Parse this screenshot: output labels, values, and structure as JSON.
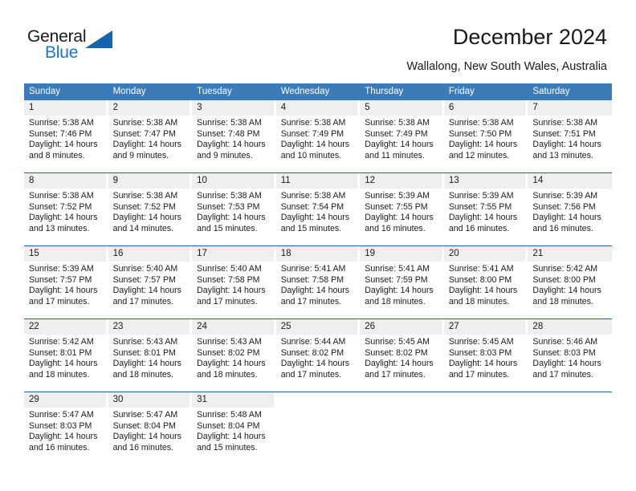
{
  "brand": {
    "name_part1": "General",
    "name_part2": "Blue",
    "accent_color": "#1565ac",
    "logo_icon": "triangle-flag-icon"
  },
  "header": {
    "title": "December 2024",
    "subtitle": "Wallalong, New South Wales, Australia"
  },
  "calendar": {
    "header_bg": "#3b7cb8",
    "daynum_bg": "#efefef",
    "row_border_color": "#1565ac",
    "weekdays": [
      "Sunday",
      "Monday",
      "Tuesday",
      "Wednesday",
      "Thursday",
      "Friday",
      "Saturday"
    ],
    "weeks": [
      [
        {
          "day": "1",
          "sunrise": "Sunrise: 5:38 AM",
          "sunset": "Sunset: 7:46 PM",
          "daylight_line1": "Daylight: 14 hours",
          "daylight_line2": "and 8 minutes."
        },
        {
          "day": "2",
          "sunrise": "Sunrise: 5:38 AM",
          "sunset": "Sunset: 7:47 PM",
          "daylight_line1": "Daylight: 14 hours",
          "daylight_line2": "and 9 minutes."
        },
        {
          "day": "3",
          "sunrise": "Sunrise: 5:38 AM",
          "sunset": "Sunset: 7:48 PM",
          "daylight_line1": "Daylight: 14 hours",
          "daylight_line2": "and 9 minutes."
        },
        {
          "day": "4",
          "sunrise": "Sunrise: 5:38 AM",
          "sunset": "Sunset: 7:49 PM",
          "daylight_line1": "Daylight: 14 hours",
          "daylight_line2": "and 10 minutes."
        },
        {
          "day": "5",
          "sunrise": "Sunrise: 5:38 AM",
          "sunset": "Sunset: 7:49 PM",
          "daylight_line1": "Daylight: 14 hours",
          "daylight_line2": "and 11 minutes."
        },
        {
          "day": "6",
          "sunrise": "Sunrise: 5:38 AM",
          "sunset": "Sunset: 7:50 PM",
          "daylight_line1": "Daylight: 14 hours",
          "daylight_line2": "and 12 minutes."
        },
        {
          "day": "7",
          "sunrise": "Sunrise: 5:38 AM",
          "sunset": "Sunset: 7:51 PM",
          "daylight_line1": "Daylight: 14 hours",
          "daylight_line2": "and 13 minutes."
        }
      ],
      [
        {
          "day": "8",
          "sunrise": "Sunrise: 5:38 AM",
          "sunset": "Sunset: 7:52 PM",
          "daylight_line1": "Daylight: 14 hours",
          "daylight_line2": "and 13 minutes."
        },
        {
          "day": "9",
          "sunrise": "Sunrise: 5:38 AM",
          "sunset": "Sunset: 7:52 PM",
          "daylight_line1": "Daylight: 14 hours",
          "daylight_line2": "and 14 minutes."
        },
        {
          "day": "10",
          "sunrise": "Sunrise: 5:38 AM",
          "sunset": "Sunset: 7:53 PM",
          "daylight_line1": "Daylight: 14 hours",
          "daylight_line2": "and 15 minutes."
        },
        {
          "day": "11",
          "sunrise": "Sunrise: 5:38 AM",
          "sunset": "Sunset: 7:54 PM",
          "daylight_line1": "Daylight: 14 hours",
          "daylight_line2": "and 15 minutes."
        },
        {
          "day": "12",
          "sunrise": "Sunrise: 5:39 AM",
          "sunset": "Sunset: 7:55 PM",
          "daylight_line1": "Daylight: 14 hours",
          "daylight_line2": "and 16 minutes."
        },
        {
          "day": "13",
          "sunrise": "Sunrise: 5:39 AM",
          "sunset": "Sunset: 7:55 PM",
          "daylight_line1": "Daylight: 14 hours",
          "daylight_line2": "and 16 minutes."
        },
        {
          "day": "14",
          "sunrise": "Sunrise: 5:39 AM",
          "sunset": "Sunset: 7:56 PM",
          "daylight_line1": "Daylight: 14 hours",
          "daylight_line2": "and 16 minutes."
        }
      ],
      [
        {
          "day": "15",
          "sunrise": "Sunrise: 5:39 AM",
          "sunset": "Sunset: 7:57 PM",
          "daylight_line1": "Daylight: 14 hours",
          "daylight_line2": "and 17 minutes."
        },
        {
          "day": "16",
          "sunrise": "Sunrise: 5:40 AM",
          "sunset": "Sunset: 7:57 PM",
          "daylight_line1": "Daylight: 14 hours",
          "daylight_line2": "and 17 minutes."
        },
        {
          "day": "17",
          "sunrise": "Sunrise: 5:40 AM",
          "sunset": "Sunset: 7:58 PM",
          "daylight_line1": "Daylight: 14 hours",
          "daylight_line2": "and 17 minutes."
        },
        {
          "day": "18",
          "sunrise": "Sunrise: 5:41 AM",
          "sunset": "Sunset: 7:58 PM",
          "daylight_line1": "Daylight: 14 hours",
          "daylight_line2": "and 17 minutes."
        },
        {
          "day": "19",
          "sunrise": "Sunrise: 5:41 AM",
          "sunset": "Sunset: 7:59 PM",
          "daylight_line1": "Daylight: 14 hours",
          "daylight_line2": "and 18 minutes."
        },
        {
          "day": "20",
          "sunrise": "Sunrise: 5:41 AM",
          "sunset": "Sunset: 8:00 PM",
          "daylight_line1": "Daylight: 14 hours",
          "daylight_line2": "and 18 minutes."
        },
        {
          "day": "21",
          "sunrise": "Sunrise: 5:42 AM",
          "sunset": "Sunset: 8:00 PM",
          "daylight_line1": "Daylight: 14 hours",
          "daylight_line2": "and 18 minutes."
        }
      ],
      [
        {
          "day": "22",
          "sunrise": "Sunrise: 5:42 AM",
          "sunset": "Sunset: 8:01 PM",
          "daylight_line1": "Daylight: 14 hours",
          "daylight_line2": "and 18 minutes."
        },
        {
          "day": "23",
          "sunrise": "Sunrise: 5:43 AM",
          "sunset": "Sunset: 8:01 PM",
          "daylight_line1": "Daylight: 14 hours",
          "daylight_line2": "and 18 minutes."
        },
        {
          "day": "24",
          "sunrise": "Sunrise: 5:43 AM",
          "sunset": "Sunset: 8:02 PM",
          "daylight_line1": "Daylight: 14 hours",
          "daylight_line2": "and 18 minutes."
        },
        {
          "day": "25",
          "sunrise": "Sunrise: 5:44 AM",
          "sunset": "Sunset: 8:02 PM",
          "daylight_line1": "Daylight: 14 hours",
          "daylight_line2": "and 17 minutes."
        },
        {
          "day": "26",
          "sunrise": "Sunrise: 5:45 AM",
          "sunset": "Sunset: 8:02 PM",
          "daylight_line1": "Daylight: 14 hours",
          "daylight_line2": "and 17 minutes."
        },
        {
          "day": "27",
          "sunrise": "Sunrise: 5:45 AM",
          "sunset": "Sunset: 8:03 PM",
          "daylight_line1": "Daylight: 14 hours",
          "daylight_line2": "and 17 minutes."
        },
        {
          "day": "28",
          "sunrise": "Sunrise: 5:46 AM",
          "sunset": "Sunset: 8:03 PM",
          "daylight_line1": "Daylight: 14 hours",
          "daylight_line2": "and 17 minutes."
        }
      ],
      [
        {
          "day": "29",
          "sunrise": "Sunrise: 5:47 AM",
          "sunset": "Sunset: 8:03 PM",
          "daylight_line1": "Daylight: 14 hours",
          "daylight_line2": "and 16 minutes."
        },
        {
          "day": "30",
          "sunrise": "Sunrise: 5:47 AM",
          "sunset": "Sunset: 8:04 PM",
          "daylight_line1": "Daylight: 14 hours",
          "daylight_line2": "and 16 minutes."
        },
        {
          "day": "31",
          "sunrise": "Sunrise: 5:48 AM",
          "sunset": "Sunset: 8:04 PM",
          "daylight_line1": "Daylight: 14 hours",
          "daylight_line2": "and 15 minutes."
        },
        {
          "day": "",
          "sunrise": "",
          "sunset": "",
          "daylight_line1": "",
          "daylight_line2": ""
        },
        {
          "day": "",
          "sunrise": "",
          "sunset": "",
          "daylight_line1": "",
          "daylight_line2": ""
        },
        {
          "day": "",
          "sunrise": "",
          "sunset": "",
          "daylight_line1": "",
          "daylight_line2": ""
        },
        {
          "day": "",
          "sunrise": "",
          "sunset": "",
          "daylight_line1": "",
          "daylight_line2": ""
        }
      ]
    ]
  }
}
